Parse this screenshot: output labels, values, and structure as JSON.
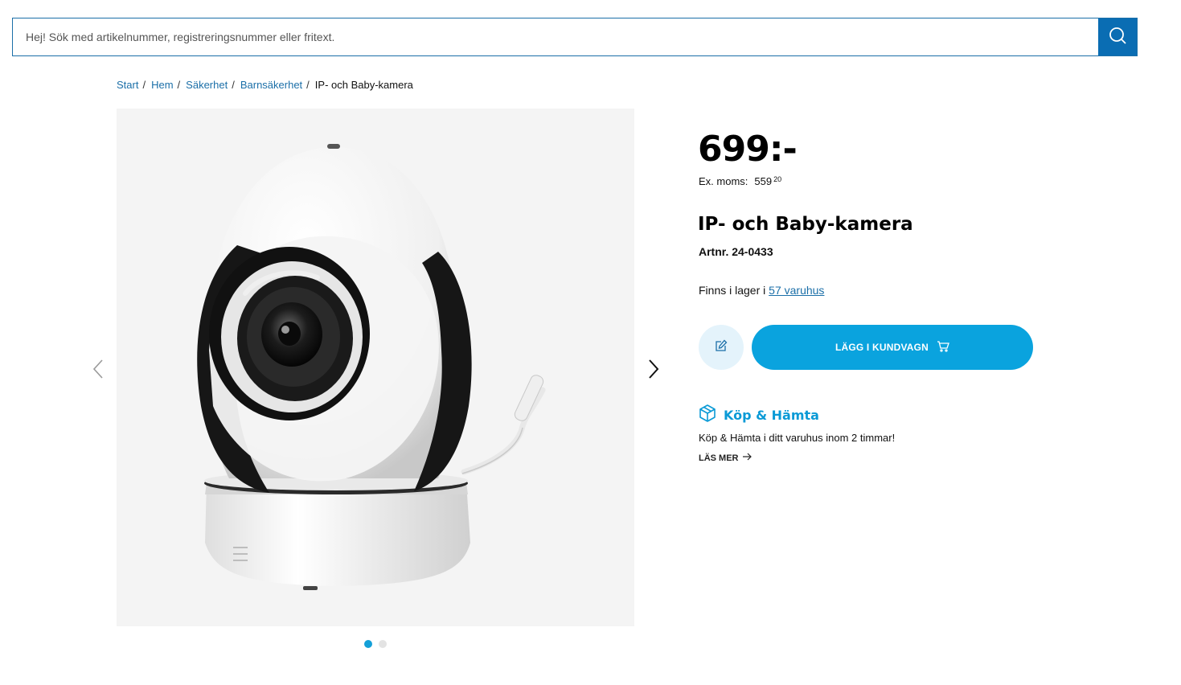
{
  "search": {
    "placeholder": "Hej! Sök med artikelnummer, registreringsnummer eller fritext."
  },
  "breadcrumb": {
    "items": [
      "Start",
      "Hem",
      "Säkerhet",
      "Barnsäkerhet"
    ],
    "current": "IP- och Baby-kamera"
  },
  "gallery": {
    "slide_count": 2,
    "active_slide": 1
  },
  "product": {
    "price": "699:-",
    "vat_label": "Ex. moms:",
    "vat_value": "559",
    "vat_cents": "20",
    "title": "IP- och Baby-kamera",
    "artnr": "Artnr. 24-0433",
    "stock_prefix": "Finns i lager i ",
    "stock_link": "57 varuhus"
  },
  "actions": {
    "cart_label": "LÄGG I KUNDVAGN"
  },
  "pickup": {
    "title": "Köp & Hämta",
    "text": "Köp & Hämta i ditt varuhus inom 2 timmar!",
    "more": "LÄS MER"
  },
  "colors": {
    "accent": "#0aa3de",
    "link": "#1b6fa8",
    "search_button": "#0a6db3"
  }
}
